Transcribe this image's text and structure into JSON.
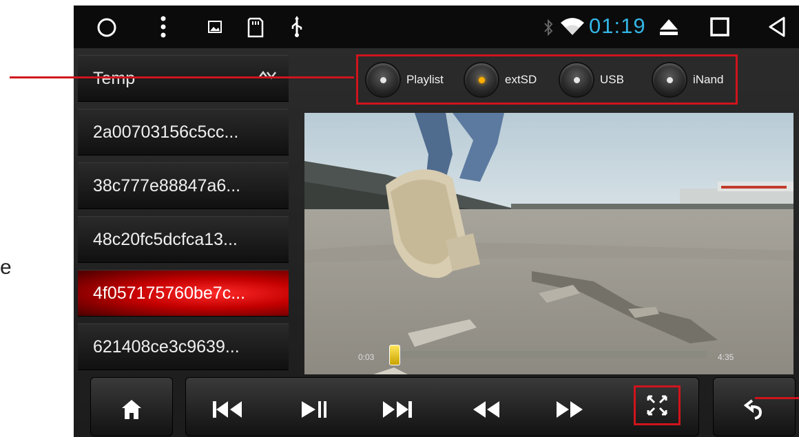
{
  "statusbar": {
    "time": "01:19",
    "icons": [
      "circle-icon",
      "menu-dots-icon",
      "image-icon",
      "sd-card-icon",
      "usb-icon",
      "bluetooth-icon",
      "wifi-icon",
      "eject-icon",
      "square-icon",
      "back-triangle-icon"
    ]
  },
  "stray_text": "e",
  "sidebar": {
    "header": "Temp",
    "items": [
      {
        "label": "2a00703156c5cc..."
      },
      {
        "label": "38c777e88847a6..."
      },
      {
        "label": "48c20fc5dcfca13..."
      },
      {
        "label": "4f057175760be7c...",
        "selected": true
      },
      {
        "label": "621408ce3c9639..."
      }
    ]
  },
  "sources": [
    {
      "label": "Playlist",
      "active": false
    },
    {
      "label": "extSD",
      "active": true
    },
    {
      "label": "USB",
      "active": false
    },
    {
      "label": "iNand",
      "active": false
    }
  ],
  "player": {
    "time_elapsed": "0:03",
    "time_total": "4:35",
    "progress": 0.01
  },
  "controls": [
    "home-icon",
    "previous-icon",
    "play-pause-icon",
    "next-icon",
    "rewind-icon",
    "fast-forward-icon",
    "fullscreen-icon",
    "back-arrow-icon"
  ],
  "colors": {
    "accent": "#33b5e5",
    "highlight": "#d0141c",
    "selected": "#c40000"
  }
}
